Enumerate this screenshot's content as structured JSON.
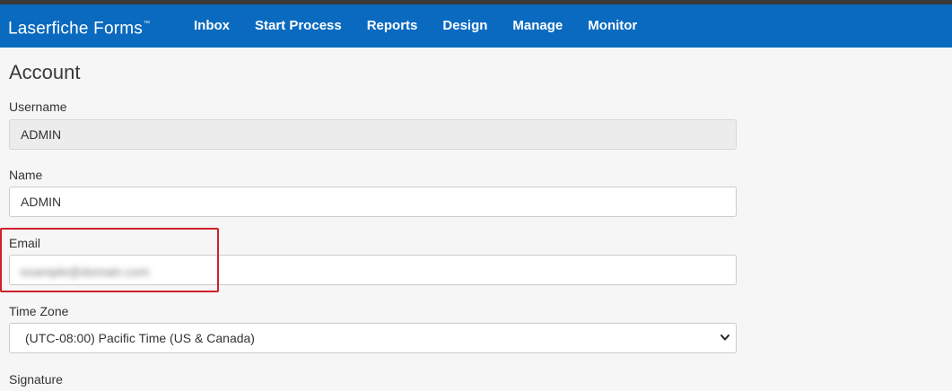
{
  "app": {
    "brand": "Laserfiche Forms",
    "trademark": "™"
  },
  "nav": {
    "items": [
      {
        "label": "Inbox"
      },
      {
        "label": "Start Process"
      },
      {
        "label": "Reports"
      },
      {
        "label": "Design"
      },
      {
        "label": "Manage"
      },
      {
        "label": "Monitor"
      }
    ]
  },
  "page": {
    "title": "Account"
  },
  "form": {
    "username": {
      "label": "Username",
      "value": "ADMIN"
    },
    "name": {
      "label": "Name",
      "value": "ADMIN"
    },
    "email": {
      "label": "Email",
      "value": "example@domain.com"
    },
    "timezone": {
      "label": "Time Zone",
      "value": "(UTC-08:00) Pacific Time (US & Canada)"
    },
    "signature": {
      "label": "Signature"
    }
  },
  "colors": {
    "navbar": "#0a6abf",
    "highlight": "#d0202b"
  }
}
